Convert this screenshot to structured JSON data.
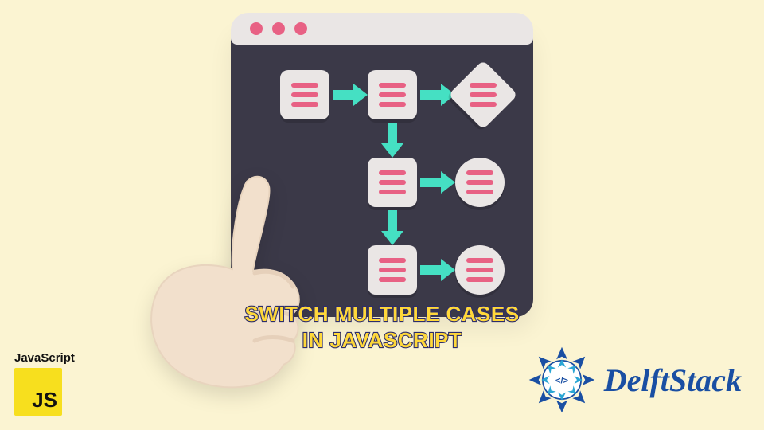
{
  "title_line1": "Switch Multiple Cases",
  "title_line2": "in Javascript",
  "js_badge": {
    "label": "JavaScript",
    "initials": "JS"
  },
  "brand": {
    "name": "DelftStack",
    "glyph": "</>"
  },
  "colors": {
    "background": "#fbf4d2",
    "window_body": "#3b3948",
    "window_header": "#eae6e5",
    "accent_pink": "#e86184",
    "accent_teal": "#45e0c3",
    "title_fill": "#ffd83a",
    "title_stroke": "#2c2c6b",
    "js_yellow": "#f7df1e",
    "brand_blue": "#1a4fa3"
  },
  "icons": {
    "header_dots": 3,
    "node_bar_count": 3,
    "shapes": [
      "square",
      "square",
      "diamond",
      "square",
      "circle",
      "square",
      "circle"
    ]
  }
}
